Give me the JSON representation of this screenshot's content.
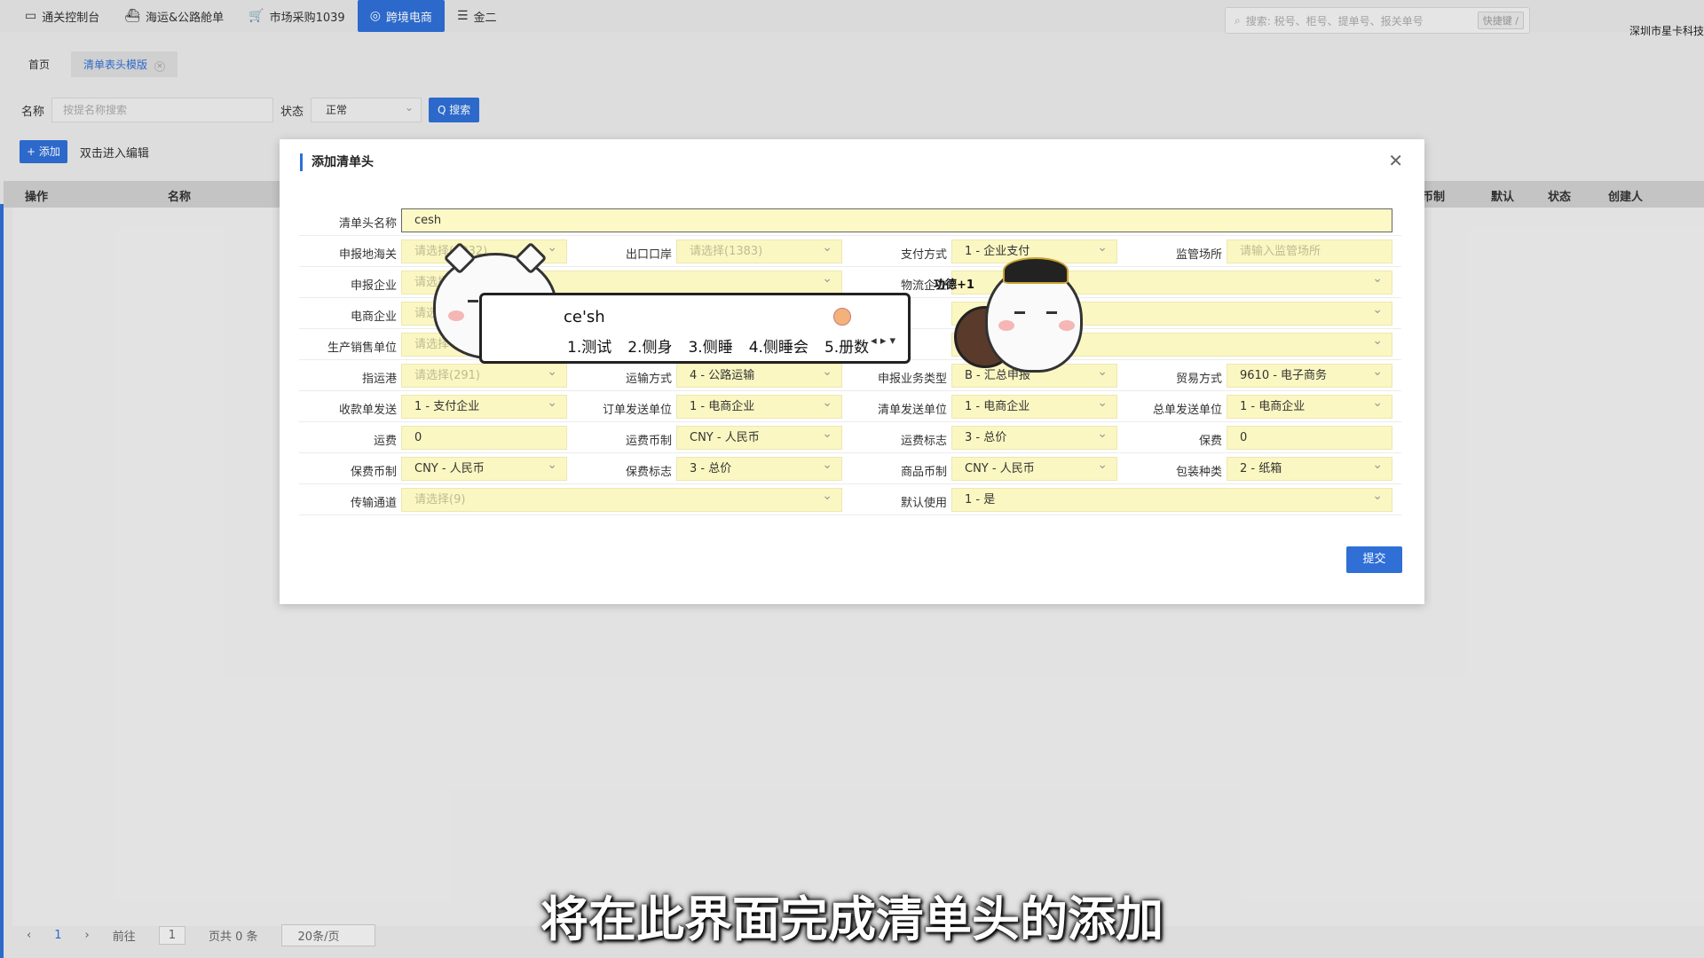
{
  "topnav": [
    {
      "label": "通关控制台",
      "icon": "monitor-icon",
      "glyph": "▭"
    },
    {
      "label": "海运&公路舱单",
      "icon": "ship-icon",
      "glyph": "⛴"
    },
    {
      "label": "市场采购1039",
      "icon": "cart-icon",
      "glyph": "🛒"
    },
    {
      "label": "跨境电商",
      "icon": "globe-icon",
      "glyph": "◎",
      "active": true
    },
    {
      "label": "金二",
      "icon": "stack-icon",
      "glyph": "☰"
    }
  ],
  "search": {
    "placeholder": "搜索: 税号、柜号、提单号、报关单号",
    "shortcut": "快捷键 /"
  },
  "company": "深圳市星卡科技",
  "tabs": {
    "home": "首页",
    "current": "清单表头模版"
  },
  "filter": {
    "name_label": "名称",
    "name_placeholder": "按提名称搜索",
    "status_label": "状态",
    "status_value": "正常",
    "search_button": "Q 搜索"
  },
  "actions": {
    "add": "+ 添加",
    "hint": "双击进入编辑"
  },
  "table_headers": {
    "op": "操作",
    "name": "名称",
    "currency": "币制",
    "default": "默认",
    "status": "状态",
    "creator": "创建人"
  },
  "pager": {
    "prev": "‹",
    "page": "1",
    "next": "›",
    "goto": "前往",
    "goto_value": "1",
    "total": "页共 0 条",
    "size": "20条/页"
  },
  "modal": {
    "title": "添加清单头",
    "close": "✕",
    "submit": "提交",
    "name_label": "清单头名称",
    "name_value": "cesh",
    "rows": [
      [
        {
          "label": "申报地海关",
          "value": "请选择(1032)",
          "ph": true
        },
        {
          "label": "出口口岸",
          "value": "请选择(1383)",
          "ph": true
        },
        {
          "label": "支付方式",
          "value": "1 - 企业支付"
        },
        {
          "label": "监管场所",
          "value": "请输入监管场所",
          "ph": true,
          "nodd": true
        }
      ],
      [
        {
          "label": "申报企业",
          "value": "请选择",
          "ph": true,
          "wide": true
        },
        {
          "label": "物流企业",
          "value": "",
          "wide": true
        }
      ],
      [
        {
          "label": "电商企业",
          "value": "请选择",
          "ph": true,
          "wide": true
        },
        {
          "label": "",
          "value": "",
          "wide": true
        }
      ],
      [
        {
          "label": "生产销售单位",
          "value": "请选择",
          "ph": true,
          "wide": true
        },
        {
          "label": "",
          "value": "",
          "wide": true
        }
      ],
      [
        {
          "label": "指运港",
          "value": "请选择(291)",
          "ph": true
        },
        {
          "label": "运输方式",
          "value": "4 - 公路运输"
        },
        {
          "label": "申报业务类型",
          "value": "B - 汇总申报"
        },
        {
          "label": "贸易方式",
          "value": "9610 - 电子商务"
        }
      ],
      [
        {
          "label": "收款单发送",
          "value": "1 - 支付企业"
        },
        {
          "label": "订单发送单位",
          "value": "1 - 电商企业"
        },
        {
          "label": "清单发送单位",
          "value": "1 - 电商企业"
        },
        {
          "label": "总单发送单位",
          "value": "1 - 电商企业"
        }
      ],
      [
        {
          "label": "运费",
          "value": "0",
          "nodd": true
        },
        {
          "label": "运费币制",
          "value": "CNY - 人民币"
        },
        {
          "label": "运费标志",
          "value": "3 - 总价"
        },
        {
          "label": "保费",
          "value": "0",
          "nodd": true
        }
      ],
      [
        {
          "label": "保费币制",
          "value": "CNY - 人民币"
        },
        {
          "label": "保费标志",
          "value": "3 - 总价"
        },
        {
          "label": "商品币制",
          "value": "CNY - 人民币"
        },
        {
          "label": "包装种类",
          "value": "2 - 纸箱"
        }
      ],
      [
        {
          "label": "传输通道",
          "value": "请选择(9)",
          "ph": true,
          "wide": true
        },
        {
          "label": "默认使用",
          "value": "1 - 是",
          "wide": true
        }
      ]
    ]
  },
  "ime": {
    "composition": "ce'sh",
    "candidates": [
      "1.测试",
      "2.侧身",
      "3.侧睡",
      "4.侧睡会",
      "5.册数"
    ],
    "arrows": "◂ ▸ ▾",
    "badge": "功德+1"
  },
  "subtitle": "将在此界面完成清单头的添加"
}
